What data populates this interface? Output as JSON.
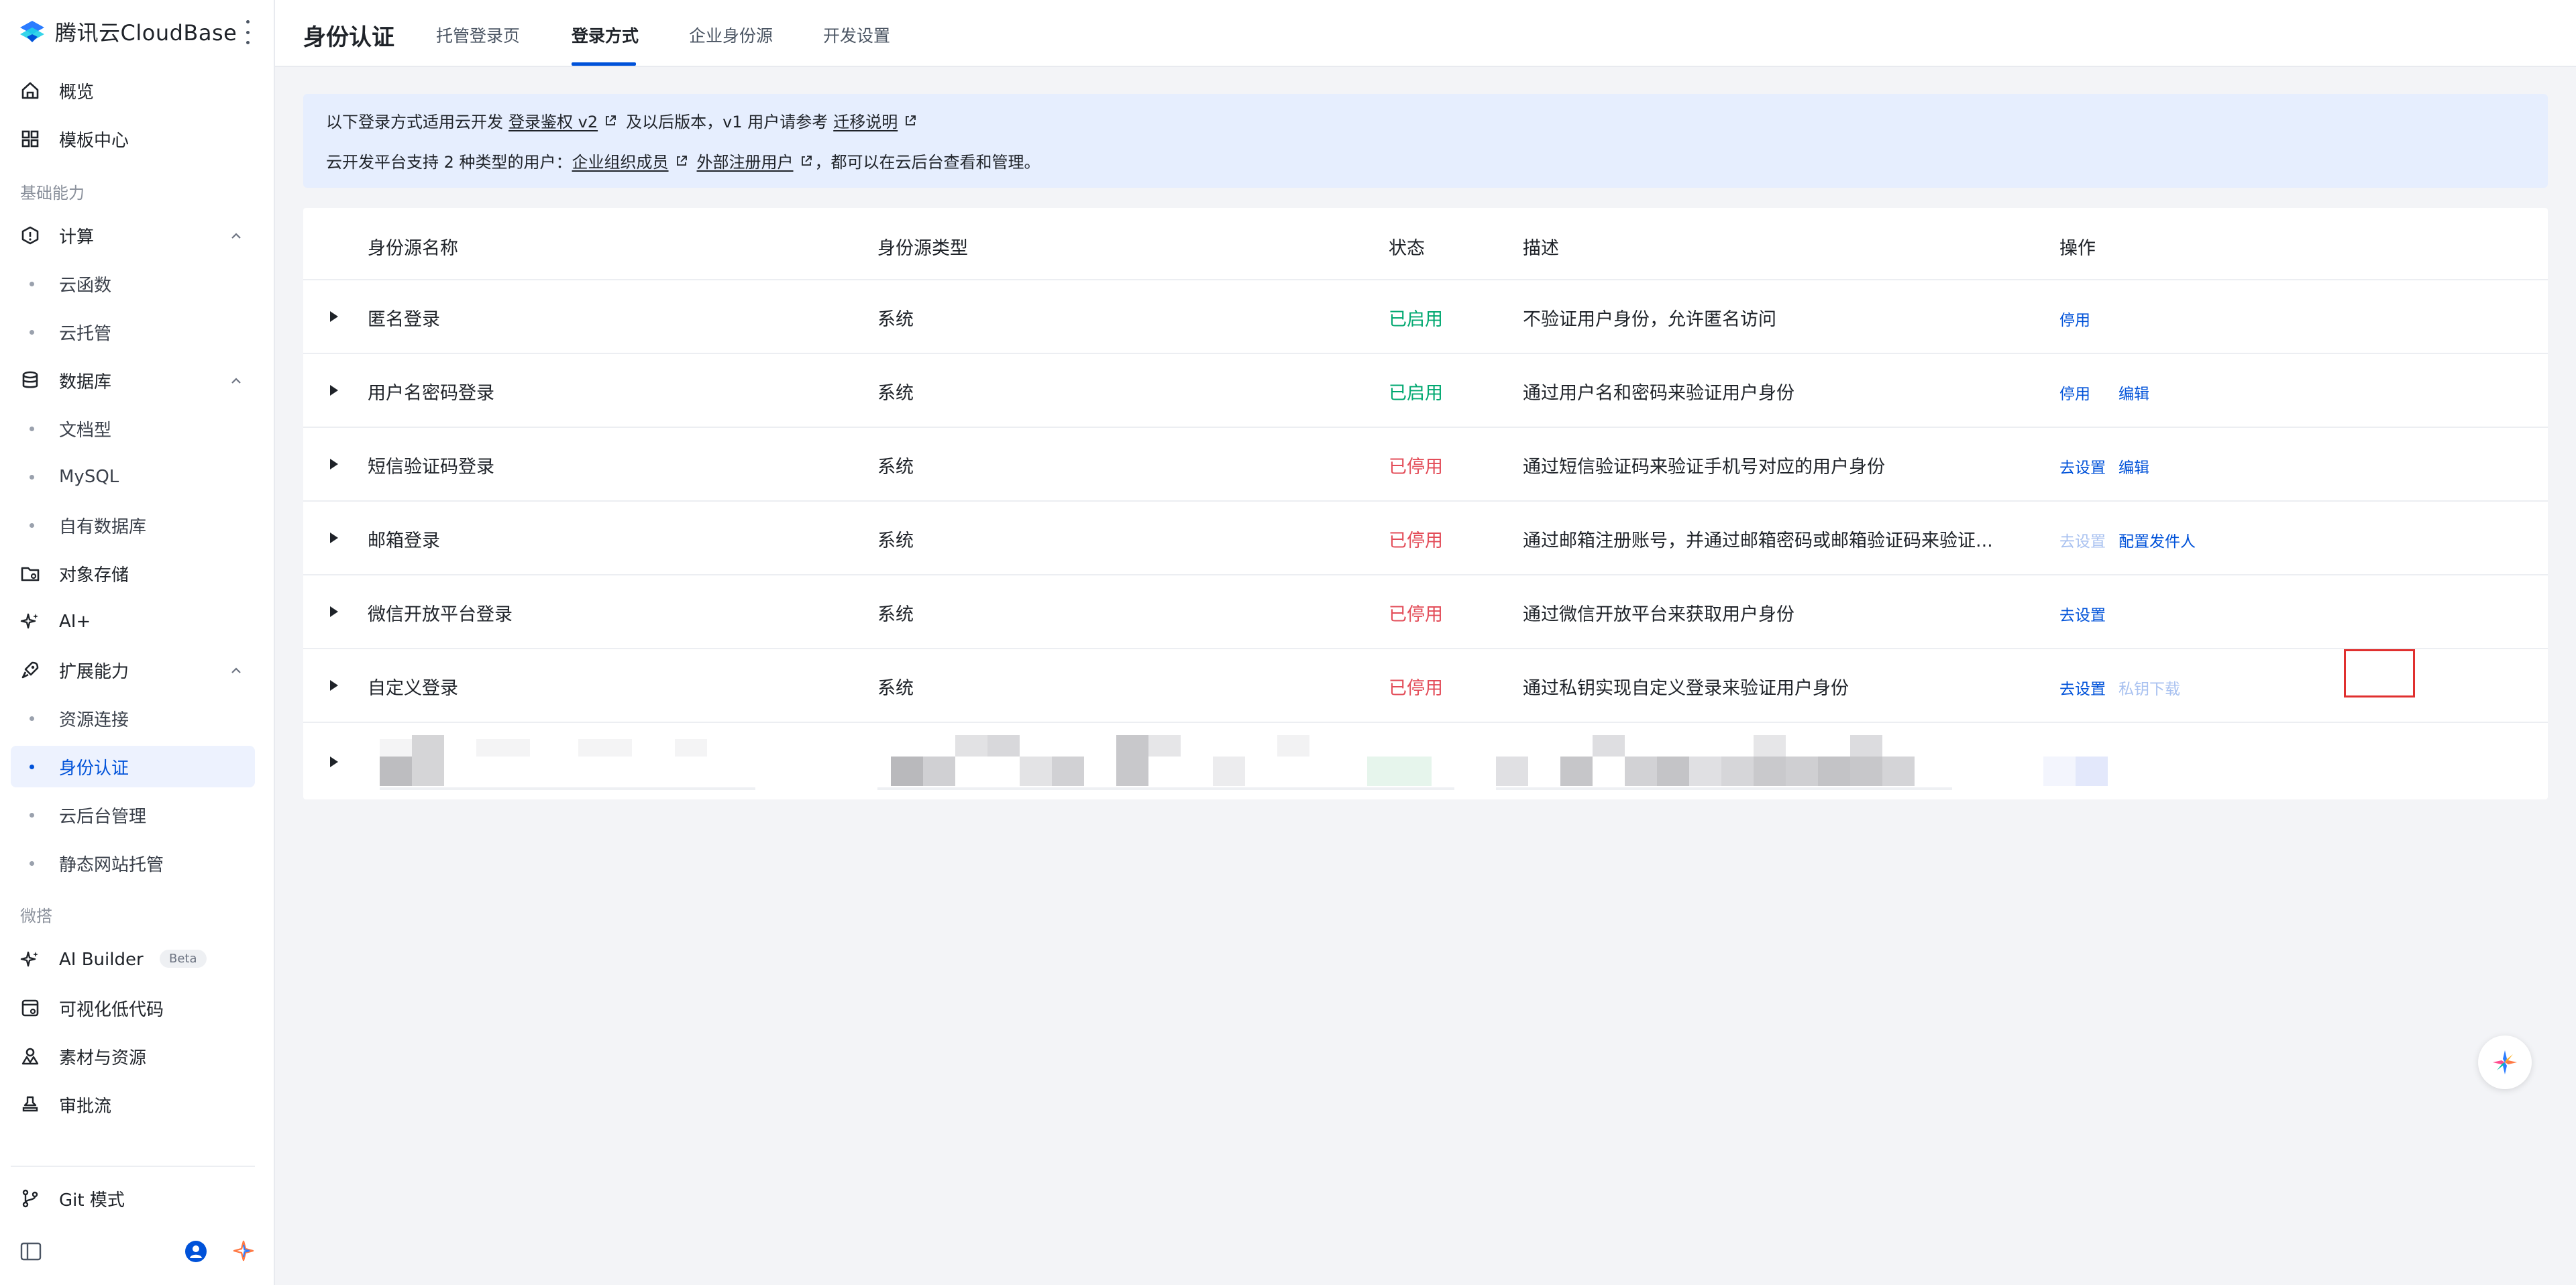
{
  "brand": {
    "name": "腾讯云CloudBase"
  },
  "sidebar": {
    "overview": "概览",
    "templates": "模板中心",
    "group_basic": "基础能力",
    "compute": "计算",
    "cloud_functions": "云函数",
    "cloud_hosting": "云托管",
    "database": "数据库",
    "doc_db": "文档型",
    "mysql": "MySQL",
    "own_db": "自有数据库",
    "storage": "对象存储",
    "ai": "AI+",
    "extensions": "扩展能力",
    "resource_conn": "资源连接",
    "identity": "身份认证",
    "backend_mgmt": "云后台管理",
    "static_hosting": "静态网站托管",
    "group_micro": "微搭",
    "ai_builder": "AI Builder",
    "beta": "Beta",
    "lowcode": "可视化低代码",
    "assets": "素材与资源",
    "approval": "审批流",
    "git_mode": "Git 模式"
  },
  "header": {
    "title": "身份认证",
    "tabs": [
      "托管登录页",
      "登录方式",
      "企业身份源",
      "开发设置"
    ],
    "active_tab": 1
  },
  "notice": {
    "line1_prefix": "以下登录方式适用云开发",
    "line1_link1": "登录鉴权 v2",
    "line1_mid": "及以后版本，v1 用户请参考",
    "line1_link2": "迁移说明",
    "line2_prefix": "云开发平台支持 2 种类型的用户：",
    "line2_link1": "企业组织成员",
    "line2_link2": "外部注册用户",
    "line2_suffix": "，都可以在云后台查看和管理。"
  },
  "table": {
    "headers": [
      "身份源名称",
      "身份源类型",
      "状态",
      "描述",
      "操作"
    ],
    "rows": [
      {
        "name": "匿名登录",
        "type": "系统",
        "status": "已启用",
        "desc": "不验证用户身份，允许匿名访问",
        "actions": [
          "停用"
        ]
      },
      {
        "name": "用户名密码登录",
        "type": "系统",
        "status": "已启用",
        "desc": "通过用户名和密码来验证用户身份",
        "actions": [
          "停用",
          "编辑"
        ]
      },
      {
        "name": "短信验证码登录",
        "type": "系统",
        "status": "已停用",
        "desc": "通过短信验证码来验证手机号对应的用户身份",
        "actions": [
          "去设置",
          "编辑"
        ]
      },
      {
        "name": "邮箱登录",
        "type": "系统",
        "status": "已停用",
        "desc": "通过邮箱注册账号，并通过邮箱密码或邮箱验证码来验证...",
        "actions": [
          "去设置",
          "配置发件人"
        ]
      },
      {
        "name": "微信开放平台登录",
        "type": "系统",
        "status": "已停用",
        "desc": "通过微信开放平台来获取用户身份",
        "actions": [
          "去设置"
        ]
      },
      {
        "name": "自定义登录",
        "type": "系统",
        "status": "已停用",
        "desc": "通过私钥实现自定义登录来验证用户身份",
        "actions": [
          "去设置",
          "私钥下载"
        ]
      }
    ]
  },
  "colors": {
    "accent": "#0052d9",
    "enabled": "#00a870",
    "disabled": "#e34d59",
    "notice_bg": "#e6eefe",
    "highlight": "#e0302f"
  }
}
